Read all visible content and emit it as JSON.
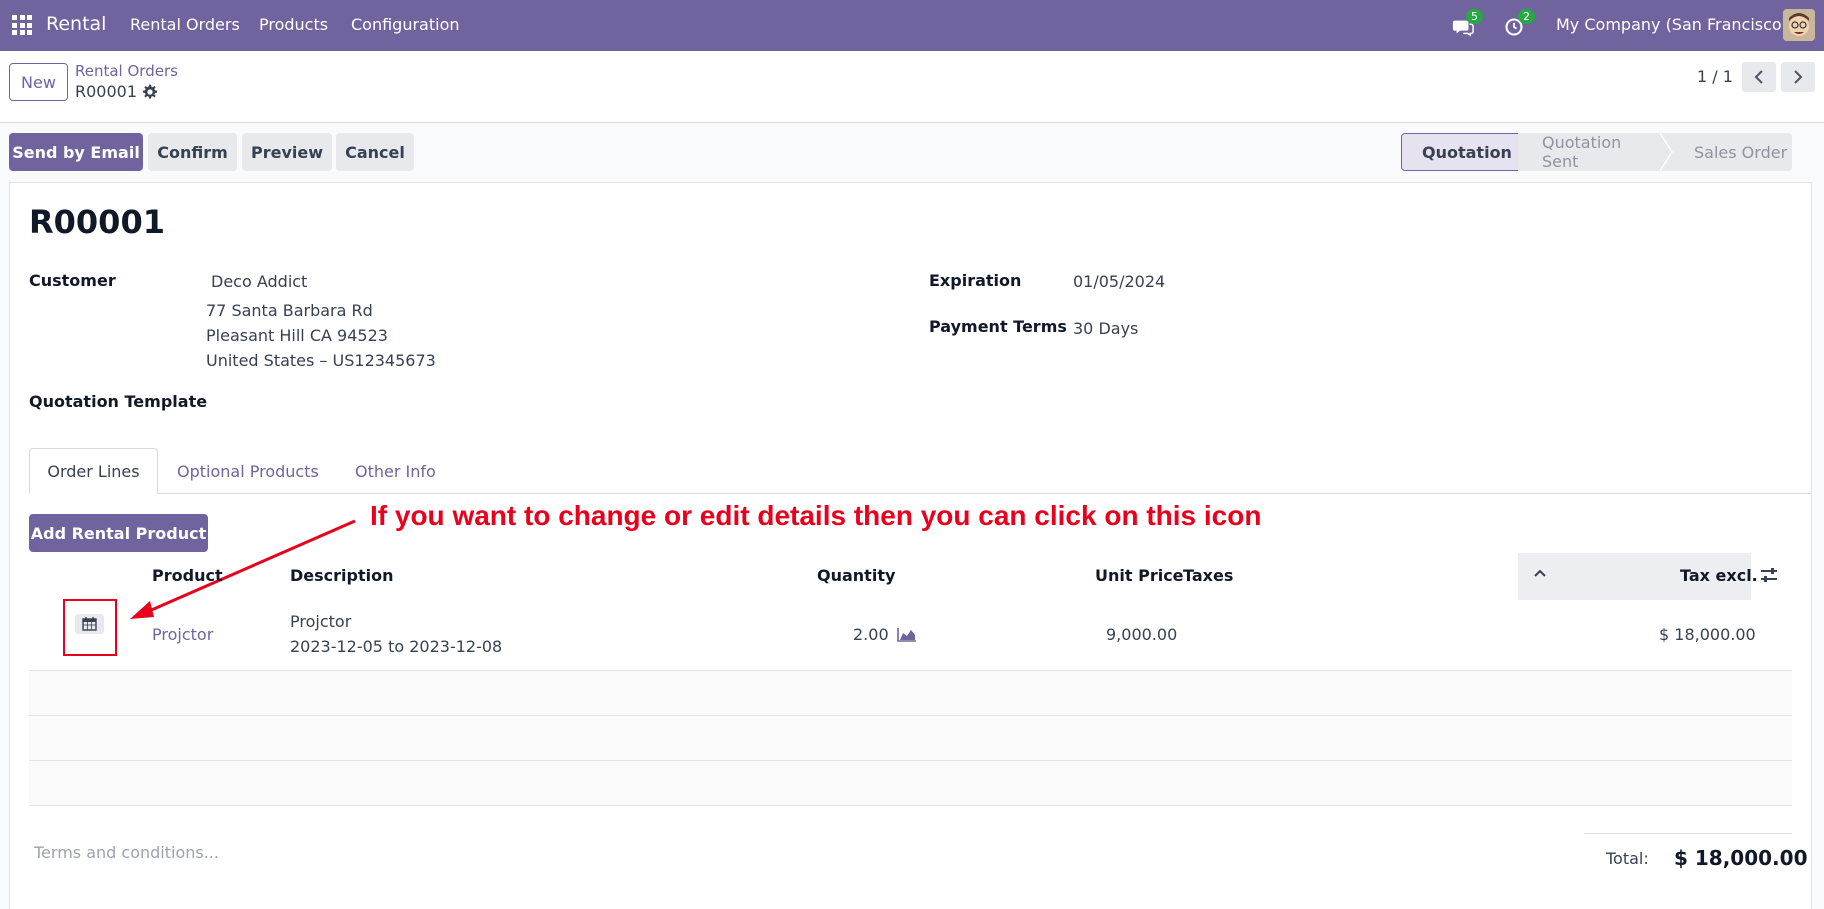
{
  "navbar": {
    "app_name": "Rental",
    "menu": [
      "Rental Orders",
      "Products",
      "Configuration"
    ],
    "messages_count": "5",
    "activities_count": "2",
    "company": "My Company (San Francisco)"
  },
  "control_panel": {
    "new_label": "New",
    "breadcrumb_parent": "Rental Orders",
    "breadcrumb_current": "R00001",
    "pager": "1 / 1"
  },
  "actions": {
    "send_email": "Send by Email",
    "confirm": "Confirm",
    "preview": "Preview",
    "cancel": "Cancel"
  },
  "status_stages": [
    "Quotation",
    "Quotation Sent",
    "Sales Order"
  ],
  "form": {
    "name": "R00001",
    "customer_label": "Customer",
    "customer_name": "Deco Addict",
    "address_1": "77 Santa Barbara Rd",
    "address_2": "Pleasant Hill CA 94523",
    "address_3": "United States – US12345673",
    "quotation_template_label": "Quotation Template",
    "expiration_label": "Expiration",
    "expiration_value": "01/05/2024",
    "payment_terms_label": "Payment Terms",
    "payment_terms_value": "30 Days"
  },
  "tabs": [
    "Order Lines",
    "Optional Products",
    "Other Info"
  ],
  "add_rental_product": "Add Rental Product",
  "annotation": "If you want to change or edit details then you can click on this icon",
  "table": {
    "headers": {
      "product": "Product",
      "description": "Description",
      "quantity": "Quantity",
      "unit_price": "Unit Price",
      "taxes": "Taxes",
      "tax_excl": "Tax excl."
    },
    "rows": [
      {
        "product": "Projctor",
        "description_1": "Projctor",
        "description_2": "2023-12-05 to 2023-12-08",
        "quantity": "2.00",
        "unit_price": "9,000.00",
        "taxes": "",
        "subtotal": "$ 18,000.00"
      }
    ]
  },
  "footer": {
    "terms_placeholder": "Terms and conditions...",
    "total_label": "Total:",
    "total_value": "$ 18,000.00"
  },
  "colors": {
    "brand": "#71639e",
    "annotation": "#e8001c"
  }
}
